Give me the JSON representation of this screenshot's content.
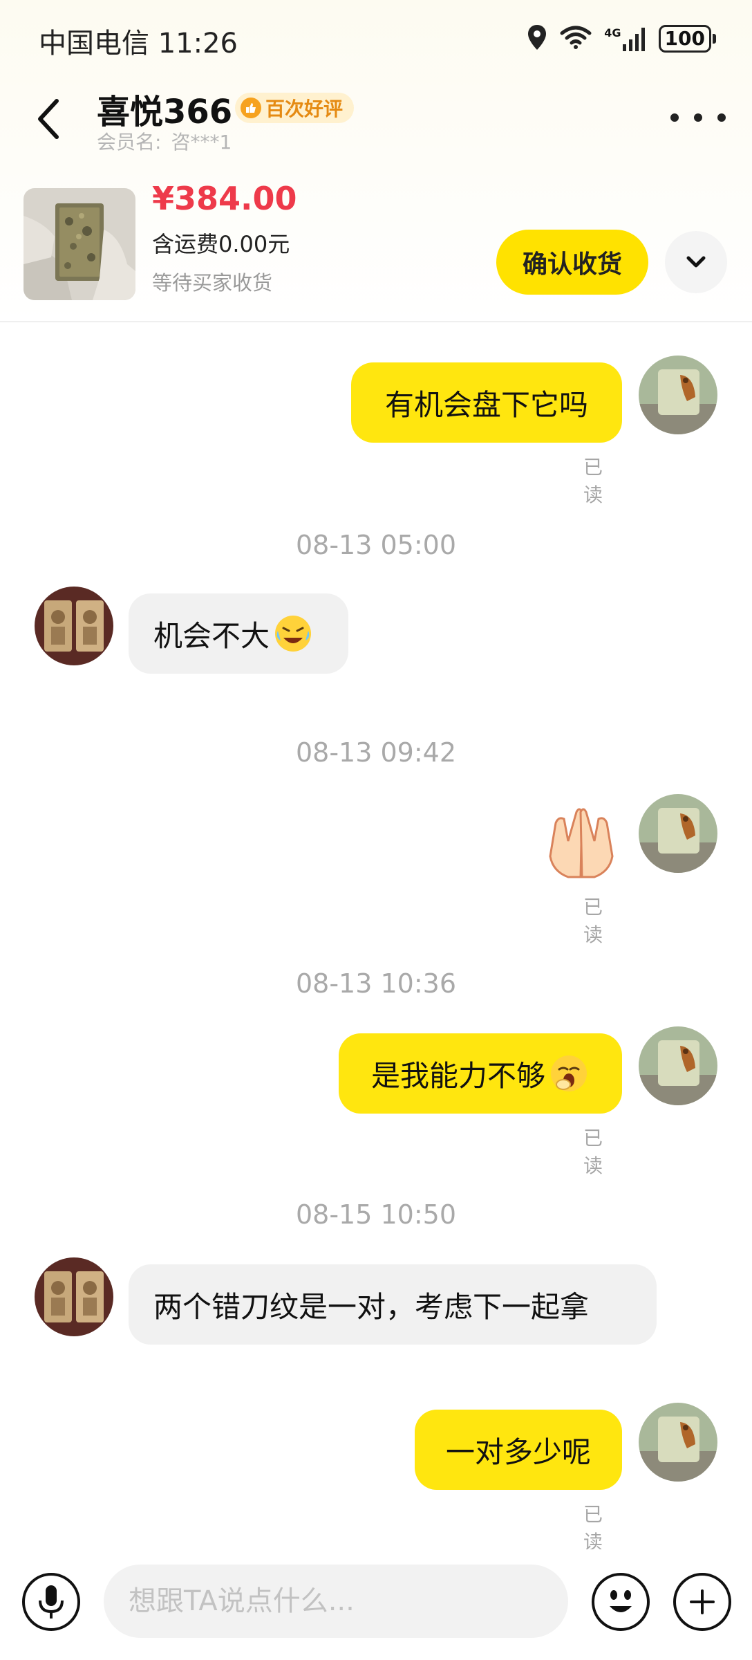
{
  "status_bar": {
    "carrier_time": "中国电信 11:26",
    "network": "4G",
    "battery": "100"
  },
  "header": {
    "name": "喜悦366",
    "badge": "百次好评",
    "member_label": "会员名:",
    "member_value": "咨***1"
  },
  "product": {
    "price": "¥384.00",
    "shipping": "含运费0.00元",
    "status": "等待买家收货",
    "confirm_label": "确认收货"
  },
  "messages": {
    "m1": {
      "text": "有机会盘下它吗",
      "read": "已读"
    },
    "t1": "08-13 05:00",
    "m2": {
      "text": "机会不大"
    },
    "t2": "08-13 09:42",
    "m3": {
      "read": "已读"
    },
    "t3": "08-13 10:36",
    "m4": {
      "text": "是我能力不够",
      "read": "已读"
    },
    "t4": "08-15 10:50",
    "m5": {
      "text": "两个错刀纹是一对，考虑下一起拿"
    },
    "m6": {
      "text": "一对多少呢",
      "read": "已读"
    }
  },
  "input": {
    "placeholder": "想跟TA说点什么..."
  },
  "colors": {
    "accent": "#ffe60f",
    "price": "#ee3a4a",
    "badge": "#f6a21f"
  },
  "icons": [
    "back-icon",
    "more-icon",
    "chevron-down-icon",
    "microphone-icon",
    "emoji-icon",
    "plus-icon",
    "location-icon",
    "wifi-icon",
    "signal-icon",
    "battery-icon"
  ]
}
